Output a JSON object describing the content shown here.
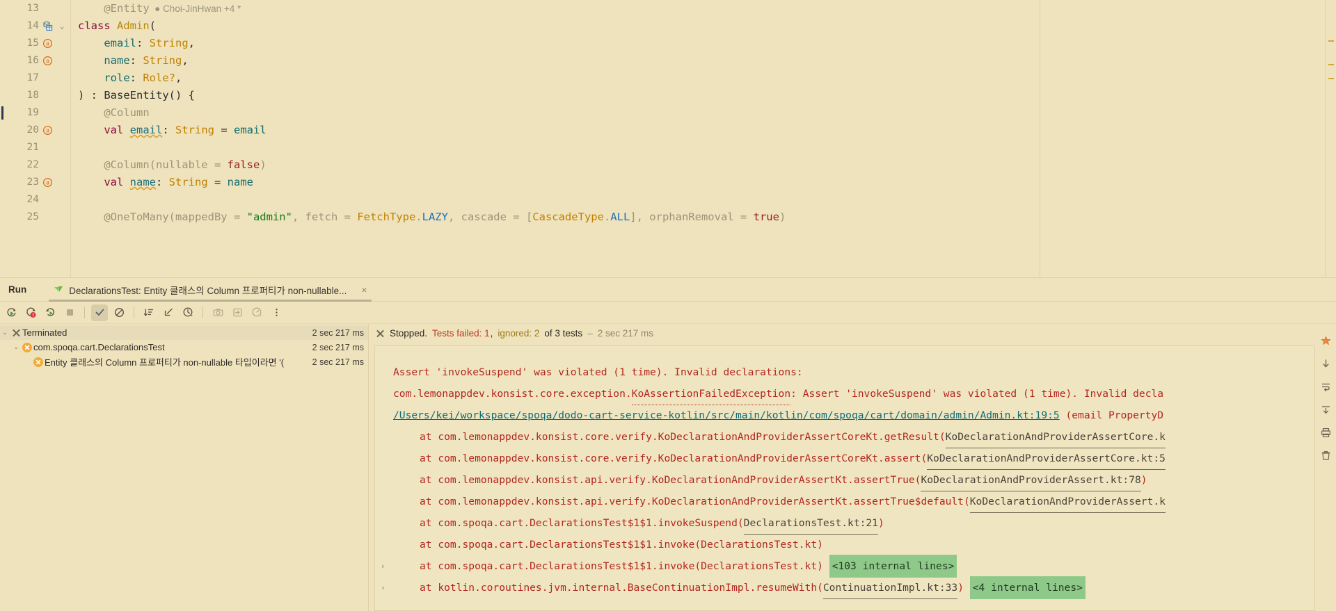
{
  "theme": {
    "background": "#efe3bd",
    "console_background": "#f0e5c1",
    "error_color": "#b3261e",
    "link_color": "#0f6b78",
    "highlight_green": "#8fc98a",
    "warning_orange": "#f2a93b",
    "failed_red": "#c0392b"
  },
  "editor": {
    "lines": [
      {
        "number": "13",
        "gutter_icon": "none",
        "fold": false,
        "caret": false,
        "tokens": [
          {
            "text": "    ",
            "cls": "plain"
          },
          {
            "text": "@Entity",
            "cls": "anno"
          }
        ],
        "inlay": "Choi-JinHwan +4 *"
      },
      {
        "number": "14",
        "gutter_icon": "database-icon",
        "fold": true,
        "caret": false,
        "tokens": [
          {
            "text": "class ",
            "cls": "kw"
          },
          {
            "text": "Admin",
            "cls": "cls"
          },
          {
            "text": "(",
            "cls": "plain"
          }
        ],
        "inlay": ""
      },
      {
        "number": "15",
        "gutter_icon": "annotation-icon",
        "fold": false,
        "caret": false,
        "tokens": [
          {
            "text": "    ",
            "cls": "plain"
          },
          {
            "text": "email",
            "cls": "param"
          },
          {
            "text": ": ",
            "cls": "plain"
          },
          {
            "text": "String",
            "cls": "type"
          },
          {
            "text": ",",
            "cls": "plain"
          }
        ],
        "inlay": ""
      },
      {
        "number": "16",
        "gutter_icon": "annotation-icon",
        "fold": false,
        "caret": false,
        "tokens": [
          {
            "text": "    ",
            "cls": "plain"
          },
          {
            "text": "name",
            "cls": "param"
          },
          {
            "text": ": ",
            "cls": "plain"
          },
          {
            "text": "String",
            "cls": "type"
          },
          {
            "text": ",",
            "cls": "plain"
          }
        ],
        "inlay": ""
      },
      {
        "number": "17",
        "gutter_icon": "none",
        "fold": false,
        "caret": false,
        "tokens": [
          {
            "text": "    ",
            "cls": "plain"
          },
          {
            "text": "role",
            "cls": "param"
          },
          {
            "text": ": ",
            "cls": "plain"
          },
          {
            "text": "Role?",
            "cls": "type"
          },
          {
            "text": ",",
            "cls": "plain"
          }
        ],
        "inlay": ""
      },
      {
        "number": "18",
        "gutter_icon": "none",
        "fold": false,
        "caret": false,
        "tokens": [
          {
            "text": ") : ",
            "cls": "plain"
          },
          {
            "text": "BaseEntity",
            "cls": "plain"
          },
          {
            "text": "() {",
            "cls": "plain"
          }
        ],
        "inlay": ""
      },
      {
        "number": "19",
        "gutter_icon": "none",
        "fold": false,
        "caret": true,
        "tokens": [
          {
            "text": "    ",
            "cls": "plain"
          },
          {
            "text": "@Column",
            "cls": "anno"
          }
        ],
        "inlay": ""
      },
      {
        "number": "20",
        "gutter_icon": "annotation-icon",
        "fold": false,
        "caret": false,
        "tokens": [
          {
            "text": "    ",
            "cls": "plain"
          },
          {
            "text": "val ",
            "cls": "kw"
          },
          {
            "text": "email",
            "cls": "prop wavy"
          },
          {
            "text": ": ",
            "cls": "plain"
          },
          {
            "text": "String",
            "cls": "type"
          },
          {
            "text": " = ",
            "cls": "plain"
          },
          {
            "text": "email",
            "cls": "param"
          }
        ],
        "inlay": ""
      },
      {
        "number": "21",
        "gutter_icon": "none",
        "fold": false,
        "caret": false,
        "tokens": [],
        "inlay": ""
      },
      {
        "number": "22",
        "gutter_icon": "none",
        "fold": false,
        "caret": false,
        "tokens": [
          {
            "text": "    ",
            "cls": "plain"
          },
          {
            "text": "@Column(nullable = ",
            "cls": "anno"
          },
          {
            "text": "false",
            "cls": "kw2"
          },
          {
            "text": ")",
            "cls": "anno"
          }
        ],
        "inlay": ""
      },
      {
        "number": "23",
        "gutter_icon": "annotation-icon",
        "fold": false,
        "caret": false,
        "tokens": [
          {
            "text": "    ",
            "cls": "plain"
          },
          {
            "text": "val ",
            "cls": "kw"
          },
          {
            "text": "name",
            "cls": "prop wavy"
          },
          {
            "text": ": ",
            "cls": "plain"
          },
          {
            "text": "String",
            "cls": "type"
          },
          {
            "text": " = ",
            "cls": "plain"
          },
          {
            "text": "name",
            "cls": "param"
          }
        ],
        "inlay": ""
      },
      {
        "number": "24",
        "gutter_icon": "none",
        "fold": false,
        "caret": false,
        "tokens": [],
        "inlay": ""
      },
      {
        "number": "25",
        "gutter_icon": "none",
        "fold": false,
        "caret": false,
        "tokens": [
          {
            "text": "    ",
            "cls": "plain"
          },
          {
            "text": "@OneToMany(mappedBy = ",
            "cls": "anno"
          },
          {
            "text": "\"admin\"",
            "cls": "str"
          },
          {
            "text": ", fetch = ",
            "cls": "anno"
          },
          {
            "text": "FetchType",
            "cls": "type"
          },
          {
            "text": ".",
            "cls": "anno"
          },
          {
            "text": "LAZY",
            "cls": "const"
          },
          {
            "text": ", cascade = [",
            "cls": "anno"
          },
          {
            "text": "CascadeType",
            "cls": "type"
          },
          {
            "text": ".",
            "cls": "anno"
          },
          {
            "text": "ALL",
            "cls": "const"
          },
          {
            "text": "], orphanRemoval = ",
            "cls": "anno"
          },
          {
            "text": "true",
            "cls": "kw2"
          },
          {
            "text": ")",
            "cls": "anno"
          }
        ],
        "inlay": ""
      }
    ]
  },
  "run_window": {
    "title": "Run",
    "tab": {
      "label": "DeclarationsTest: Entity 클래스의 Column 프로퍼티가 non-nullable...",
      "icon": "junit-leaf-icon",
      "close_label": "×"
    },
    "toolbar": [
      {
        "name": "rerun-button",
        "title": "Rerun"
      },
      {
        "name": "rerun-failed-tests-button",
        "title": "Rerun Failed Tests"
      },
      {
        "name": "toggle-auto-test-button",
        "title": "Toggle auto-test"
      },
      {
        "name": "stop-button",
        "title": "Stop"
      },
      {
        "name": "show-passed-button",
        "title": "Show Passed",
        "active": true
      },
      {
        "name": "show-ignored-button",
        "title": "Show Ignored"
      },
      {
        "name": "sort-by-duration-button",
        "title": "Sort by Duration"
      },
      {
        "name": "expand-collapse-button",
        "title": "Expand / Collapse"
      },
      {
        "name": "history-button",
        "title": "Test History"
      },
      {
        "name": "export-screenshot-button",
        "title": "Export"
      },
      {
        "name": "import-tests-button",
        "title": "Import Tests"
      },
      {
        "name": "profiler-button",
        "title": "Profiler"
      },
      {
        "name": "more-options-button",
        "title": "More"
      }
    ],
    "tree": [
      {
        "indent": 0,
        "arrow": "⌄",
        "icon": "x-icon",
        "label": "Terminated",
        "time": "2 sec 217 ms",
        "selected": true
      },
      {
        "indent": 1,
        "arrow": "⌄",
        "icon": "orange-x-icon",
        "label": "com.spoqa.cart.DeclarationsTest",
        "time": "2 sec 217 ms",
        "selected": false
      },
      {
        "indent": 2,
        "arrow": "",
        "icon": "orange-x-icon",
        "label": "Entity 클래스의 Column 프로퍼티가 non-nullable 타입이라면 '(",
        "time": "2 sec 217 ms",
        "selected": false
      }
    ],
    "status": {
      "icon": "x-icon",
      "stopped": "Stopped.",
      "failed": "Tests failed: 1",
      "comma": ",",
      "ignored": "ignored: 2",
      "of_tests": "of 3 tests",
      "dash": "–",
      "duration": "2 sec 217 ms"
    },
    "console": [
      {
        "expander": "",
        "indent": 0,
        "parts": [
          {
            "text": "Assert 'invokeSuspend' was violated (1 time). Invalid declarations:",
            "cls": "c-err"
          }
        ]
      },
      {
        "expander": "",
        "indent": 0,
        "parts": [
          {
            "text": "com.lemonappdev.konsist.core.exception.",
            "cls": "c-err"
          },
          {
            "text": "KoAssertionFailedException",
            "cls": "c-dotted"
          },
          {
            "text": ": Assert 'invokeSuspend' was violated (1 time). Invalid decla",
            "cls": "c-err"
          }
        ]
      },
      {
        "expander": "",
        "indent": 0,
        "parts": [
          {
            "text": "/Users/kei/workspace/spoqa/dodo-cart-service-kotlin/src/main/kotlin/com/spoqa/cart/domain/admin/Admin.kt:19:5",
            "cls": "c-link"
          },
          {
            "text": " (email PropertyD",
            "cls": "c-err"
          }
        ]
      },
      {
        "expander": "",
        "indent": 1,
        "parts": [
          {
            "text": "at com.lemonappdev.konsist.core.verify.KoDeclarationAndProviderAssertCoreKt.getResult(",
            "cls": "c-err"
          },
          {
            "text": "KoDeclarationAndProviderAssertCore.k",
            "cls": "c-greylink"
          }
        ]
      },
      {
        "expander": "",
        "indent": 1,
        "parts": [
          {
            "text": "at com.lemonappdev.konsist.core.verify.KoDeclarationAndProviderAssertCoreKt.assert(",
            "cls": "c-err"
          },
          {
            "text": "KoDeclarationAndProviderAssertCore.kt:5",
            "cls": "c-greylink"
          }
        ]
      },
      {
        "expander": "",
        "indent": 1,
        "parts": [
          {
            "text": "at com.lemonappdev.konsist.api.verify.KoDeclarationAndProviderAssertKt.assertTrue(",
            "cls": "c-err"
          },
          {
            "text": "KoDeclarationAndProviderAssert.kt:78",
            "cls": "c-greylink"
          },
          {
            "text": ")",
            "cls": "c-err"
          }
        ]
      },
      {
        "expander": "",
        "indent": 1,
        "parts": [
          {
            "text": "at com.lemonappdev.konsist.api.verify.KoDeclarationAndProviderAssertKt.assertTrue$default(",
            "cls": "c-err"
          },
          {
            "text": "KoDeclarationAndProviderAssert.k",
            "cls": "c-greylink"
          }
        ]
      },
      {
        "expander": "",
        "indent": 1,
        "parts": [
          {
            "text": "at com.spoqa.cart.DeclarationsTest$1$1.invokeSuspend(",
            "cls": "c-err"
          },
          {
            "text": "DeclarationsTest.kt:21",
            "cls": "c-greylink"
          },
          {
            "text": ")",
            "cls": "c-err"
          }
        ]
      },
      {
        "expander": "",
        "indent": 1,
        "parts": [
          {
            "text": "at com.spoqa.cart.DeclarationsTest$1$1.invoke(DeclarationsTest.kt)",
            "cls": "c-err"
          }
        ]
      },
      {
        "expander": "›",
        "indent": 1,
        "parts": [
          {
            "text": "at com.spoqa.cart.DeclarationsTest$1$1.invoke(DeclarationsTest.kt) ",
            "cls": "c-err"
          },
          {
            "text": "<103 internal lines>",
            "cls": "c-hl"
          }
        ]
      },
      {
        "expander": "›",
        "indent": 1,
        "parts": [
          {
            "text": "at kotlin.coroutines.jvm.internal.BaseContinuationImpl.resumeWith(",
            "cls": "c-err"
          },
          {
            "text": "ContinuationImpl.kt:33",
            "cls": "c-greylink"
          },
          {
            "text": ") ",
            "cls": "c-err"
          },
          {
            "text": "<4 internal lines>",
            "cls": "c-hl"
          }
        ]
      }
    ],
    "icon_rail": [
      {
        "name": "soft-wrap-icon"
      },
      {
        "name": "scroll-to-end-icon"
      },
      {
        "name": "prev-occurrence-icon"
      },
      {
        "name": "next-occurrence-icon"
      },
      {
        "name": "print-icon"
      },
      {
        "name": "clear-all-icon"
      }
    ]
  }
}
